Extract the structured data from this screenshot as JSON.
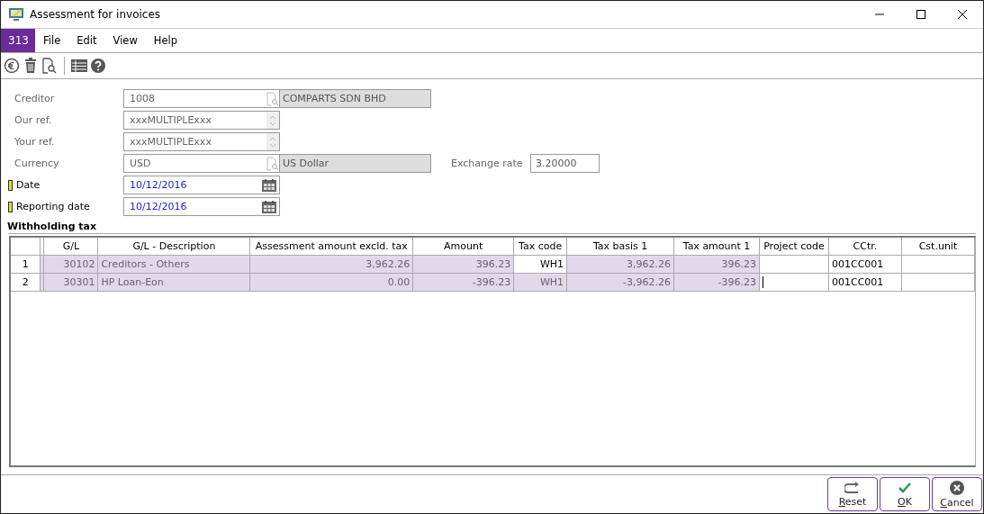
{
  "window": {
    "title": "Assessment for invoices"
  },
  "menu": {
    "badge": "313",
    "items": [
      "File",
      "Edit",
      "View",
      "Help"
    ]
  },
  "toolbar": [
    {
      "kind": "euro"
    },
    {
      "kind": "trash"
    },
    {
      "kind": "preview"
    },
    {
      "kind": "separator"
    },
    {
      "kind": "list"
    },
    {
      "kind": "help"
    }
  ],
  "form": [
    {
      "label": "Creditor",
      "kind": "lookup",
      "value": "1008",
      "name": "COMPARTS SDN BHD",
      "required": false
    },
    {
      "label": "Our ref.",
      "kind": "spinner",
      "value": "xxxMULTIPLExxx",
      "required": false
    },
    {
      "label": "Your ref.",
      "kind": "spinner",
      "value": "xxxMULTIPLExxx",
      "required": false
    },
    {
      "label": "Currency",
      "kind": "lookup",
      "value": "USD",
      "name": "US Dollar",
      "required": false,
      "extra": {
        "label": "Exchange rate",
        "value": "3.20000"
      }
    },
    {
      "label": "Date",
      "kind": "date",
      "value": "10/12/2016",
      "required": true
    },
    {
      "label": "Reporting date",
      "kind": "date",
      "value": "10/12/2016",
      "required": true
    }
  ],
  "section_title": "Withholding tax",
  "table": {
    "columns": [
      "G/L",
      "G/L - Description",
      "Assessment amount excld. tax",
      "Amount",
      "Tax code",
      "Tax basis 1",
      "Tax amount 1",
      "Project code",
      "CCtr.",
      "Cst.unit"
    ],
    "rows": [
      {
        "number": "1",
        "cells": [
          {
            "text": "30102",
            "editable": false,
            "kind": "number"
          },
          {
            "text": "Creditors - Others",
            "editable": false,
            "kind": "text"
          },
          {
            "text": "3,962.26",
            "editable": false,
            "kind": "number"
          },
          {
            "text": "396.23",
            "editable": false,
            "kind": "number"
          },
          {
            "text": "WH1",
            "editable": true,
            "kind": "number"
          },
          {
            "text": "3,962.26",
            "editable": false,
            "kind": "number"
          },
          {
            "text": "396.23",
            "editable": false,
            "kind": "number"
          },
          {
            "editable": true,
            "focused": false
          },
          {
            "text": "001CC001",
            "editable": true,
            "kind": "text"
          },
          {
            "editable": true
          }
        ]
      },
      {
        "number": "2",
        "cells": [
          {
            "text": "30301",
            "editable": false,
            "kind": "number"
          },
          {
            "text": "HP Loan-Eon",
            "editable": false,
            "kind": "text"
          },
          {
            "text": "0.00",
            "editable": false,
            "kind": "number"
          },
          {
            "text": "-396.23",
            "editable": false,
            "kind": "number"
          },
          {
            "text": "WH1",
            "editable": false,
            "kind": "number"
          },
          {
            "text": "-3,962.26",
            "editable": false,
            "kind": "number"
          },
          {
            "text": "-396.23",
            "editable": false,
            "kind": "number"
          },
          {
            "editable": true,
            "focused": true
          },
          {
            "text": "001CC001",
            "editable": true,
            "kind": "text"
          },
          {
            "editable": true
          }
        ]
      }
    ]
  },
  "buttons": [
    {
      "kind": "reset",
      "accel": "R",
      "rest": "eset"
    },
    {
      "kind": "ok",
      "accel": "O",
      "rest": "K"
    },
    {
      "kind": "cancel",
      "accel": "C",
      "rest": "ancel"
    }
  ]
}
